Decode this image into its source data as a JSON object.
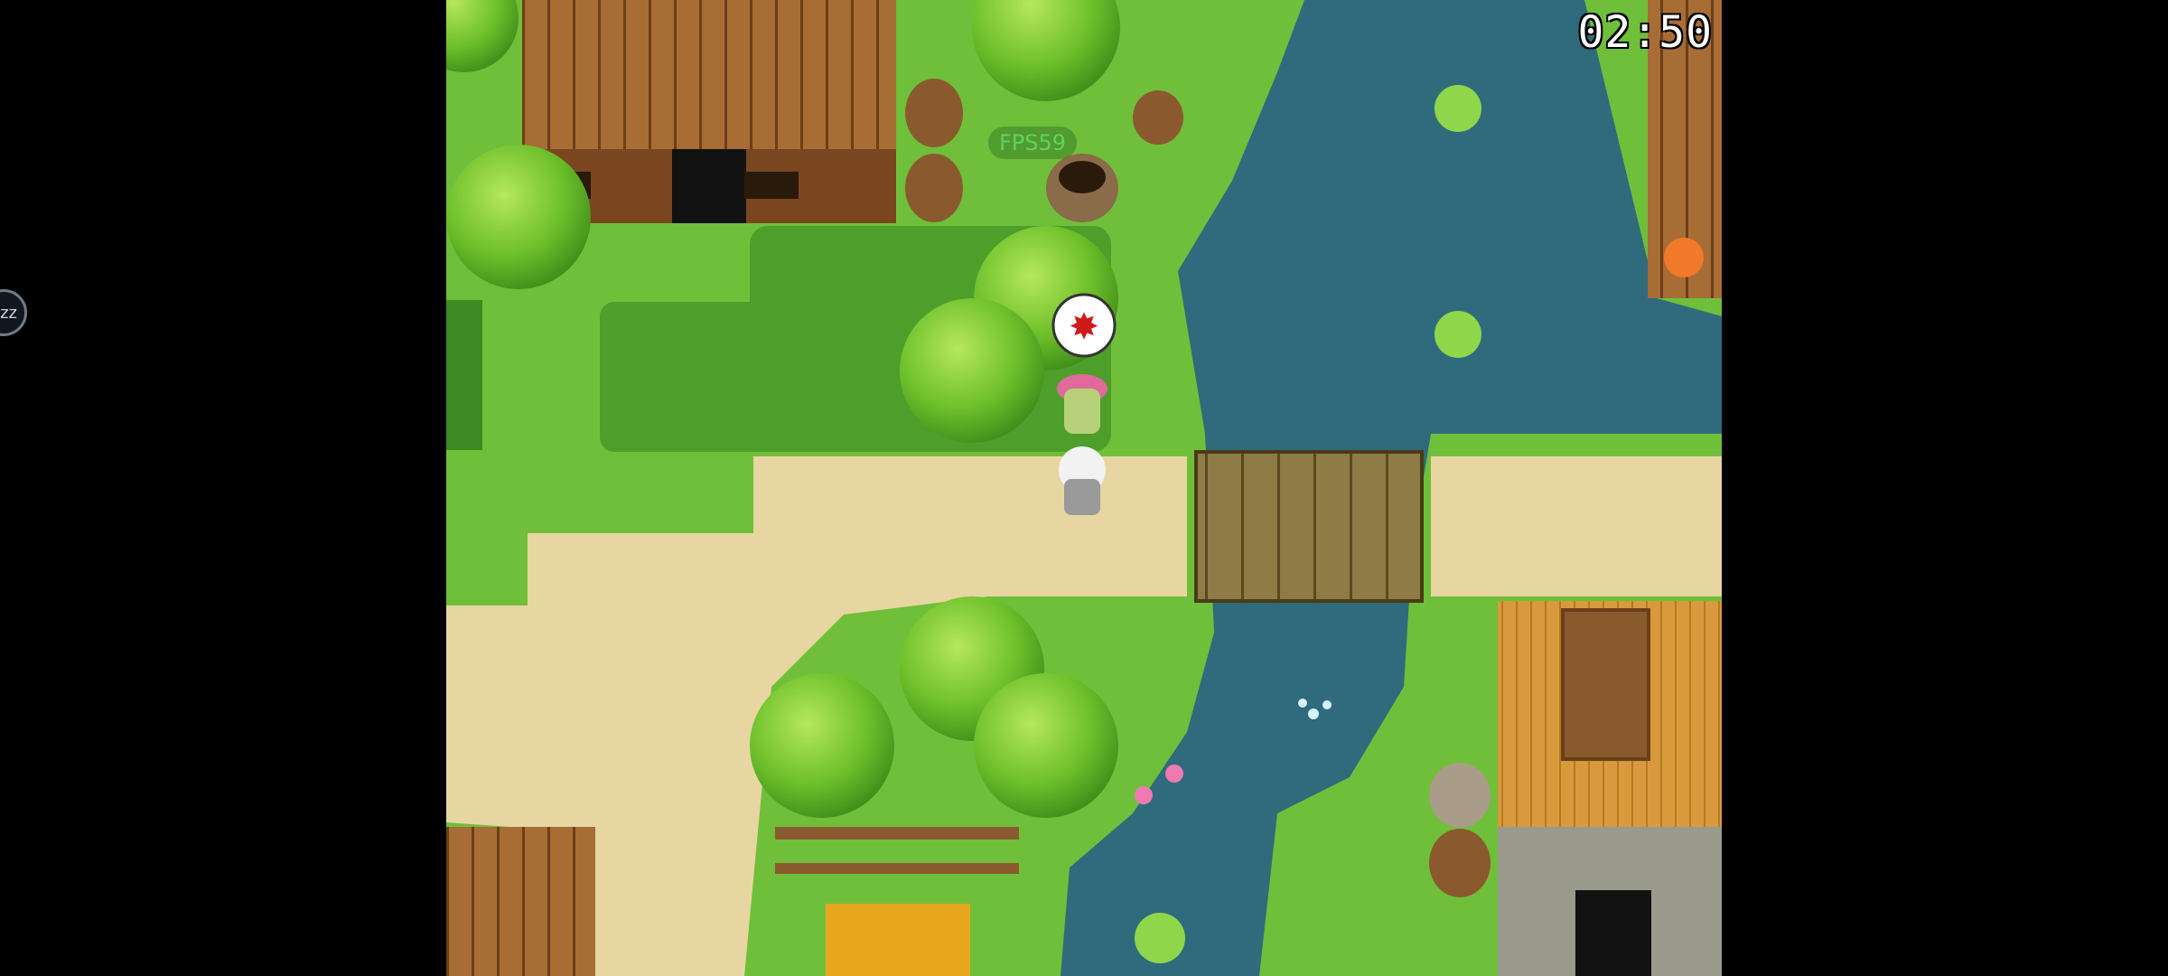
{
  "hud": {
    "timer": "02:50",
    "fps": "FPS59"
  },
  "side_button": {
    "label": "zz"
  },
  "scene": {
    "emote": "anger",
    "colors": {
      "grass": "#6fbf3a",
      "dark_grass": "#4e9e2c",
      "dirt": "#e8d6a2",
      "water": "#2f6b7d",
      "wood": "#8b5a2b",
      "roof_thatch": "#d89a3c"
    }
  }
}
